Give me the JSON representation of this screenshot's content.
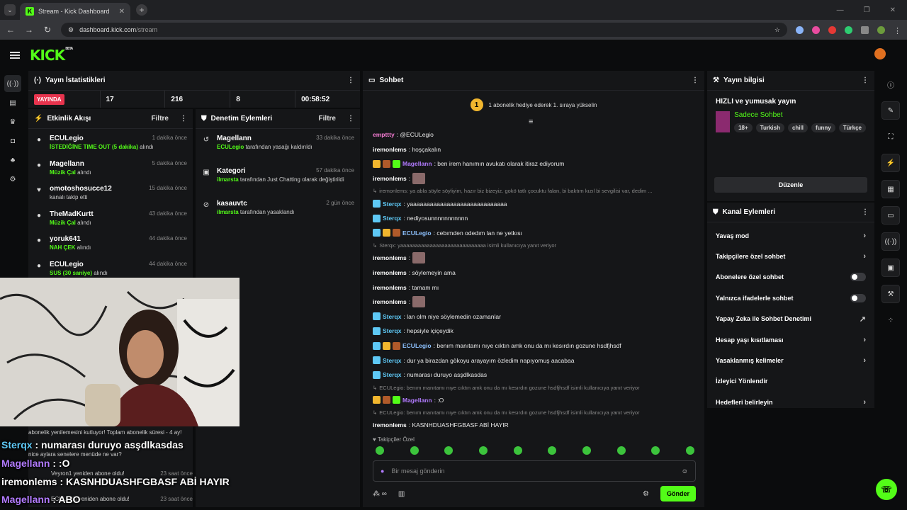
{
  "browser": {
    "tab_title": "Stream - Kick Dashboard",
    "url_host": "dashboard.kick.com",
    "url_path": "/stream"
  },
  "header": {
    "logo": "KICK",
    "beta": "BETA"
  },
  "stats": {
    "title": "Yayın İstatistikleri",
    "live_label": "YAYINDA",
    "values": [
      "17",
      "216",
      "8",
      "00:58:52"
    ]
  },
  "activity": {
    "title": "Etkinlik Akışı",
    "filter": "Filtre",
    "items": [
      {
        "name": "ECULegio",
        "time": "1 dakika önce",
        "highlight": "İSTEDİĞİNE TIME OUT (5 dakika)",
        "rest": " alındı"
      },
      {
        "name": "Magellann",
        "time": "5 dakika önce",
        "highlight": "Müzik Çal",
        "rest": " alındı"
      },
      {
        "name": "omotoshosucce12",
        "time": "15 dakika önce",
        "highlight": "",
        "rest": "kanalı takip etti"
      },
      {
        "name": "TheMadKurtt",
        "time": "43 dakika önce",
        "highlight": "Müzik Çal",
        "rest": " alındı"
      },
      {
        "name": "yoruk641",
        "time": "44 dakika önce",
        "highlight": "NAH ÇEK",
        "rest": " alındı"
      },
      {
        "name": "ECULegio",
        "time": "44 dakika önce",
        "highlight": "SUS (30 saniye)",
        "rest": " alındı"
      }
    ],
    "notes": [
      "abonelik yenilemesini kutluyor! Toplam abonelik süresi - 4 ay!",
      "nice aylara senelere menüde ne var?",
      "Veyron1 yeniden abone oldu!",
      "23 saat önce",
      "ECULegio yeniden abone oldu!",
      "23 saat önce"
    ]
  },
  "moderation": {
    "title": "Denetim Eylemleri",
    "filter": "Filtre",
    "items": [
      {
        "name": "Magellann",
        "time": "33 dakika önce",
        "actor": "ECULegio",
        "text": " tarafından yasağı kaldırıldı"
      },
      {
        "name": "Kategori",
        "time": "57 dakika önce",
        "actor": "ilmarsta",
        "text": " tarafından Just Chatting olarak değiştirildi"
      },
      {
        "name": "kasauvtc",
        "time": "2 gün önce",
        "actor": "ilmarsta",
        "text": " tarafından yasaklandı"
      }
    ]
  },
  "chat": {
    "title": "Sohbet",
    "banner": "1 abonelik hediye ederek 1. sıraya yükselin",
    "banner_rank": "1",
    "messages": [
      {
        "user": "empttty",
        "color": "#f37bd1",
        "text": ": @ECULegio"
      },
      {
        "user": "iremonlems",
        "color": "#ffffff",
        "text": ": hoşçakalın"
      },
      {
        "user": "Magellann",
        "color": "#b27bff",
        "text": ": ben irem hanımın avukatı olarak itiraz ediyorum"
      },
      {
        "user": "iremonlems",
        "color": "#ffffff",
        "text": ":"
      },
      {
        "reply": "iremonlems: ya abla söyle söyliyim, hazır biz bizeyiz. gokö tatlı çocuktu falan, bi baktım kızıl bi sevgilisi var, dedim ..."
      },
      {
        "user": "Sterqx",
        "color": "#5ec8f5",
        "text": ": yaaaaaaaaaaaaaaaaaaaaaaaaaaaaa"
      },
      {
        "user": "Sterqx",
        "color": "#5ec8f5",
        "text": ": nediyosunnnnnnnnnnn"
      },
      {
        "user": "ECULegio",
        "color": "#8ec2ff",
        "text": ": cebımden odedım lan ne yetkısı"
      },
      {
        "reply": "Sterqx: yaaaaaaaaaaaaaaaaaaaaaaaaaaaaa isimli kullanıcıya yanıt veriyor"
      },
      {
        "user": "iremonlems",
        "color": "#ffffff",
        "text": ":"
      },
      {
        "user": "iremonlems",
        "color": "#ffffff",
        "text": ": söylemeyin ama"
      },
      {
        "user": "iremonlems",
        "color": "#ffffff",
        "text": ": tamam mı"
      },
      {
        "user": "iremonlems",
        "color": "#ffffff",
        "text": ":"
      },
      {
        "user": "Sterqx",
        "color": "#5ec8f5",
        "text": ": lan olm niye söylemedin ozamanlar"
      },
      {
        "user": "Sterqx",
        "color": "#5ec8f5",
        "text": ": hepsiyle içiçeydik"
      },
      {
        "user": "ECULegio",
        "color": "#8ec2ff",
        "text": ": benım manıtamı nıye cıktın amk onu da mı kesırdın gozune hsdfjhsdf"
      },
      {
        "user": "Sterqx",
        "color": "#5ec8f5",
        "text": ": dur ya birazdan gökoyu arayayım özledim napıyomuş aacabaa"
      },
      {
        "user": "Sterqx",
        "color": "#5ec8f5",
        "text": ": numarası duruyo asşdlkasdas"
      },
      {
        "reply": "ECULegio: benım manıtamı nıye cıktın amk onu da mı kesırdın gozune hsdfjhsdf isimli kullanıcıya yanıt veriyor"
      },
      {
        "user": "Magellann",
        "color": "#b27bff",
        "text": ": :O"
      },
      {
        "reply": "ECULegio: benım manıtamı nıye cıktın amk onu da mı kesırdın gozune hsdfjhsdf isimli kullanıcıya yanıt veriyor"
      },
      {
        "user": "iremonlems",
        "color": "#ffffff",
        "text": ": KASNHDUASHFGBASF ABİ HAYIR"
      },
      {
        "user": "Magellann",
        "color": "#b27bff",
        "text": ": ABO"
      }
    ],
    "follower_label": "Takipçiler Özel",
    "placeholder": "Bir mesaj gönderin",
    "send": "Gönder"
  },
  "info": {
    "title": "Yayın bilgisi",
    "stream_title": "HIZLI ve yumusak yayın",
    "category": "Sadece Sohbet",
    "tags": [
      "18+",
      "Turkish",
      "chill",
      "funny",
      "Türkçe"
    ],
    "edit": "Düzenle"
  },
  "actions": {
    "title": "Kanal Eylemleri",
    "items": [
      {
        "label": "Yavaş mod",
        "ctl": "chev"
      },
      {
        "label": "Takipçilere özel sohbet",
        "ctl": "chev"
      },
      {
        "label": "Abonelere özel sohbet",
        "ctl": "tog"
      },
      {
        "label": "Yalnızca ifadelerle sohbet",
        "ctl": "tog"
      },
      {
        "label": "Yapay Zeka ile Sohbet Denetimi",
        "ctl": "ext"
      },
      {
        "label": "Hesap yaşı kısıtlaması",
        "ctl": "chev"
      },
      {
        "label": "Yasaklanmış kelimeler",
        "ctl": "chev"
      },
      {
        "label": "İzleyici Yönlendir",
        "ctl": "none"
      },
      {
        "label": "Hedefleri belirleyin",
        "ctl": "chev"
      }
    ]
  },
  "overlay": {
    "lines": [
      {
        "user": "Sterqx",
        "text": " : numarası duruyo asşdlkasdas",
        "color": "#5ec8f5"
      },
      {
        "user": "Magellann",
        "text": " : :O",
        "color": "#b27bff"
      },
      {
        "user": "iremonlems",
        "text": " : KASNHDUASHFGBASF ABİ HAYIR",
        "color": "#ffffff"
      },
      {
        "user": "Magellann",
        "text": " : ABO",
        "color": "#b27bff"
      }
    ]
  }
}
